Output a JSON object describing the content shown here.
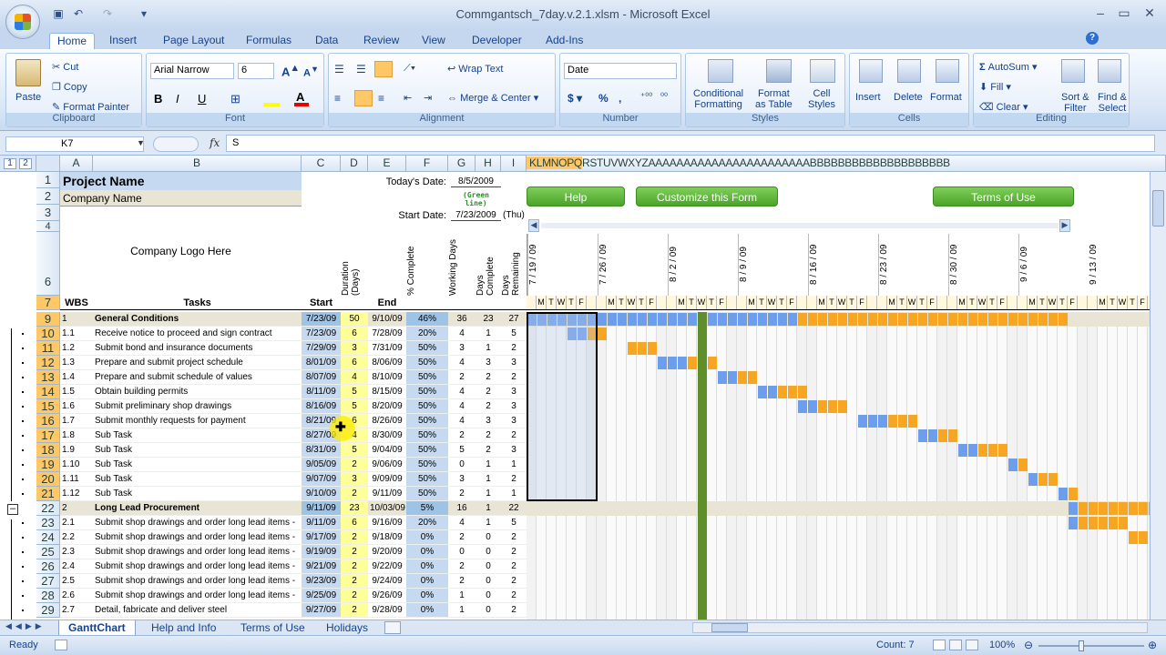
{
  "window": {
    "title": "Commgantsch_7day.v.2.1.xlsm - Microsoft Excel"
  },
  "ribbon_tabs": [
    "Home",
    "Insert",
    "Page Layout",
    "Formulas",
    "Data",
    "Review",
    "View",
    "Developer",
    "Add-Ins"
  ],
  "clipboard": {
    "paste": "Paste",
    "cut": "Cut",
    "copy": "Copy",
    "format_painter": "Format Painter",
    "label": "Clipboard"
  },
  "font": {
    "name": "Arial Narrow",
    "size": "6",
    "label": "Font"
  },
  "alignment": {
    "wrap": "Wrap Text",
    "merge": "Merge & Center",
    "label": "Alignment"
  },
  "number": {
    "format": "Date",
    "label": "Number"
  },
  "styles": {
    "conditional": "Conditional",
    "conditional2": "Formatting",
    "format_table": "Format",
    "format_table2": "as Table",
    "cell_styles": "Cell",
    "cell_styles2": "Styles",
    "label": "Styles"
  },
  "cells": {
    "insert": "Insert",
    "delete": "Delete",
    "format": "Format",
    "label": "Cells"
  },
  "editing": {
    "autosum": "AutoSum",
    "fill": "Fill",
    "clear": "Clear",
    "sort": "Sort &",
    "sort2": "Filter",
    "find": "Find &",
    "find2": "Select",
    "label": "Editing"
  },
  "formula_bar": {
    "name_box": "K7",
    "fx": "fx",
    "value": "S"
  },
  "outline_levels": [
    "1",
    "2"
  ],
  "columns": [
    "A",
    "B",
    "C",
    "D",
    "E",
    "F",
    "G",
    "H",
    "I"
  ],
  "gantt_col_header": "KLMNOPQRSTUVWXYZAAAAAAAAAAAAAAAAAAAAAAABBBBBBBBBBBBBBBBBBBB",
  "sheet": {
    "project_name": "Project Name",
    "company_name": "Company Name",
    "logo": "Company Logo Here",
    "todays_date_label": "Today's Date:",
    "todays_date": "8/5/2009",
    "green_line": "(Green line)",
    "start_date_label": "Start Date:",
    "start_date": "7/23/2009",
    "start_day": "(Thu)",
    "help": "Help",
    "customize": "Customize this Form",
    "terms": "Terms of Use",
    "headers": {
      "wbs": "WBS",
      "tasks": "Tasks",
      "start": "Start",
      "duration": "Duration (Days)",
      "end": "End",
      "pct": "% Complete",
      "working": "Working Days",
      "days_complete": "Days Complete",
      "days_remaining": "Days Remaining"
    },
    "week_dates": [
      "7 / 19 / 09",
      "7 / 26 / 09",
      "8 / 2 / 09",
      "8 / 9 / 09",
      "8 / 16 / 09",
      "8 / 23 / 09",
      "8 / 30 / 09",
      "9 / 6 / 09",
      "9 / 13 / 09"
    ],
    "day_letters": [
      "M",
      "T",
      "W",
      "T",
      "F"
    ]
  },
  "rows": [
    {
      "n": "9",
      "wbs": "1",
      "task": "General Conditions",
      "start": "7/23/09",
      "dur": "50",
      "end": "9/10/09",
      "pct": "46%",
      "wd": "36",
      "dc": "23",
      "dr": "27",
      "summary": true
    },
    {
      "n": "10",
      "wbs": "1.1",
      "task": "Receive notice to proceed and sign contract",
      "start": "7/23/09",
      "dur": "6",
      "end": "7/28/09",
      "pct": "20%",
      "wd": "4",
      "dc": "1",
      "dr": "5"
    },
    {
      "n": "11",
      "wbs": "1.2",
      "task": "Submit bond and insurance documents",
      "start": "7/29/09",
      "dur": "3",
      "end": "7/31/09",
      "pct": "50%",
      "wd": "3",
      "dc": "1",
      "dr": "2"
    },
    {
      "n": "12",
      "wbs": "1.3",
      "task": "Prepare and submit project schedule",
      "start": "8/01/09",
      "dur": "6",
      "end": "8/06/09",
      "pct": "50%",
      "wd": "4",
      "dc": "3",
      "dr": "3"
    },
    {
      "n": "13",
      "wbs": "1.4",
      "task": "Prepare and submit schedule of values",
      "start": "8/07/09",
      "dur": "4",
      "end": "8/10/09",
      "pct": "50%",
      "wd": "2",
      "dc": "2",
      "dr": "2"
    },
    {
      "n": "14",
      "wbs": "1.5",
      "task": "Obtain building permits",
      "start": "8/11/09",
      "dur": "5",
      "end": "8/15/09",
      "pct": "50%",
      "wd": "4",
      "dc": "2",
      "dr": "3"
    },
    {
      "n": "15",
      "wbs": "1.6",
      "task": "Submit preliminary shop drawings",
      "start": "8/16/09",
      "dur": "5",
      "end": "8/20/09",
      "pct": "50%",
      "wd": "4",
      "dc": "2",
      "dr": "3"
    },
    {
      "n": "16",
      "wbs": "1.7",
      "task": "Submit monthly requests for payment",
      "start": "8/21/09",
      "dur": "6",
      "end": "8/26/09",
      "pct": "50%",
      "wd": "4",
      "dc": "3",
      "dr": "3"
    },
    {
      "n": "17",
      "wbs": "1.8",
      "task": "Sub Task",
      "start": "8/27/09",
      "dur": "4",
      "end": "8/30/09",
      "pct": "50%",
      "wd": "2",
      "dc": "2",
      "dr": "2"
    },
    {
      "n": "18",
      "wbs": "1.9",
      "task": "Sub Task",
      "start": "8/31/09",
      "dur": "5",
      "end": "9/04/09",
      "pct": "50%",
      "wd": "5",
      "dc": "2",
      "dr": "3"
    },
    {
      "n": "19",
      "wbs": "1.10",
      "task": "Sub Task",
      "start": "9/05/09",
      "dur": "2",
      "end": "9/06/09",
      "pct": "50%",
      "wd": "0",
      "dc": "1",
      "dr": "1"
    },
    {
      "n": "20",
      "wbs": "1.11",
      "task": "Sub Task",
      "start": "9/07/09",
      "dur": "3",
      "end": "9/09/09",
      "pct": "50%",
      "wd": "3",
      "dc": "1",
      "dr": "2"
    },
    {
      "n": "21",
      "wbs": "1.12",
      "task": "Sub Task",
      "start": "9/10/09",
      "dur": "2",
      "end": "9/11/09",
      "pct": "50%",
      "wd": "2",
      "dc": "1",
      "dr": "1"
    },
    {
      "n": "22",
      "wbs": "2",
      "task": "Long Lead Procurement",
      "start": "9/11/09",
      "dur": "23",
      "end": "10/03/09",
      "pct": "5%",
      "wd": "16",
      "dc": "1",
      "dr": "22",
      "summary": true
    },
    {
      "n": "23",
      "wbs": "2.1",
      "task": "Submit shop drawings and order long lead items -",
      "start": "9/11/09",
      "dur": "6",
      "end": "9/16/09",
      "pct": "20%",
      "wd": "4",
      "dc": "1",
      "dr": "5"
    },
    {
      "n": "24",
      "wbs": "2.2",
      "task": "Submit shop drawings and order long lead items -",
      "start": "9/17/09",
      "dur": "2",
      "end": "9/18/09",
      "pct": "0%",
      "wd": "2",
      "dc": "0",
      "dr": "2"
    },
    {
      "n": "25",
      "wbs": "2.3",
      "task": "Submit shop drawings and order long lead items -",
      "start": "9/19/09",
      "dur": "2",
      "end": "9/20/09",
      "pct": "0%",
      "wd": "0",
      "dc": "0",
      "dr": "2"
    },
    {
      "n": "26",
      "wbs": "2.4",
      "task": "Submit shop drawings and order long lead items -",
      "start": "9/21/09",
      "dur": "2",
      "end": "9/22/09",
      "pct": "0%",
      "wd": "2",
      "dc": "0",
      "dr": "2"
    },
    {
      "n": "27",
      "wbs": "2.5",
      "task": "Submit shop drawings and order long lead items -",
      "start": "9/23/09",
      "dur": "2",
      "end": "9/24/09",
      "pct": "0%",
      "wd": "2",
      "dc": "0",
      "dr": "2"
    },
    {
      "n": "28",
      "wbs": "2.6",
      "task": "Submit shop drawings and order long lead items -",
      "start": "9/25/09",
      "dur": "2",
      "end": "9/26/09",
      "pct": "0%",
      "wd": "1",
      "dc": "0",
      "dr": "2"
    },
    {
      "n": "29",
      "wbs": "2.7",
      "task": "Detail, fabricate and deliver steel",
      "start": "9/27/09",
      "dur": "2",
      "end": "9/28/09",
      "pct": "0%",
      "wd": "1",
      "dc": "0",
      "dr": "2"
    }
  ],
  "sheet_tabs": [
    "GanttChart",
    "Help and Info",
    "Terms of Use",
    "Holidays"
  ],
  "status": {
    "ready": "Ready",
    "count": "Count: 7",
    "zoom": "100%"
  },
  "colors": {
    "blue_bar": "#6d9eeb",
    "orange_bar": "#f6a623",
    "today_line": "#5f8f2b"
  }
}
